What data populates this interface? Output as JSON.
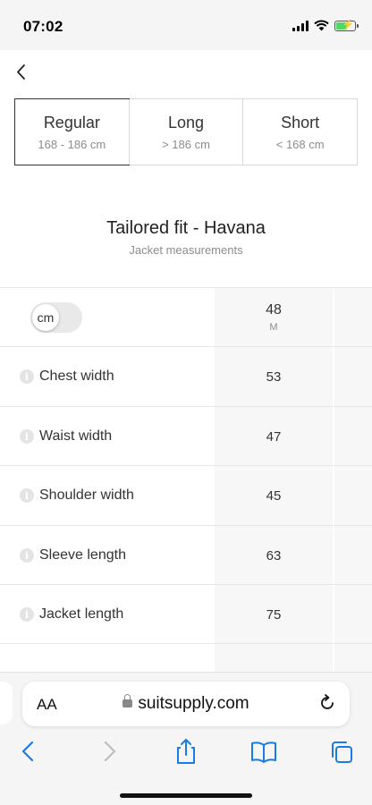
{
  "status_bar": {
    "time": "07:02"
  },
  "fit_tabs": [
    {
      "name": "Regular",
      "range": "168 - 186 cm",
      "selected": true
    },
    {
      "name": "Long",
      "range": "> 186 cm",
      "selected": false
    },
    {
      "name": "Short",
      "range": "< 168 cm",
      "selected": false
    }
  ],
  "product": {
    "title": "Tailored fit - Havana",
    "subtitle": "Jacket measurements"
  },
  "table": {
    "unit_toggle": "cm",
    "size_number": "48",
    "size_letter": "M",
    "rows": [
      {
        "label": "Chest width",
        "value": "53"
      },
      {
        "label": "Waist width",
        "value": "47"
      },
      {
        "label": "Shoulder width",
        "value": "45"
      },
      {
        "label": "Sleeve length",
        "value": "63"
      },
      {
        "label": "Jacket length",
        "value": "75"
      }
    ]
  },
  "browser": {
    "aa_label": "AA",
    "url": "suitsupply.com"
  },
  "colors": {
    "accent_blue": "#1a7ae6",
    "border": "#d8d8d8",
    "muted_text": "#8c8c8c"
  }
}
